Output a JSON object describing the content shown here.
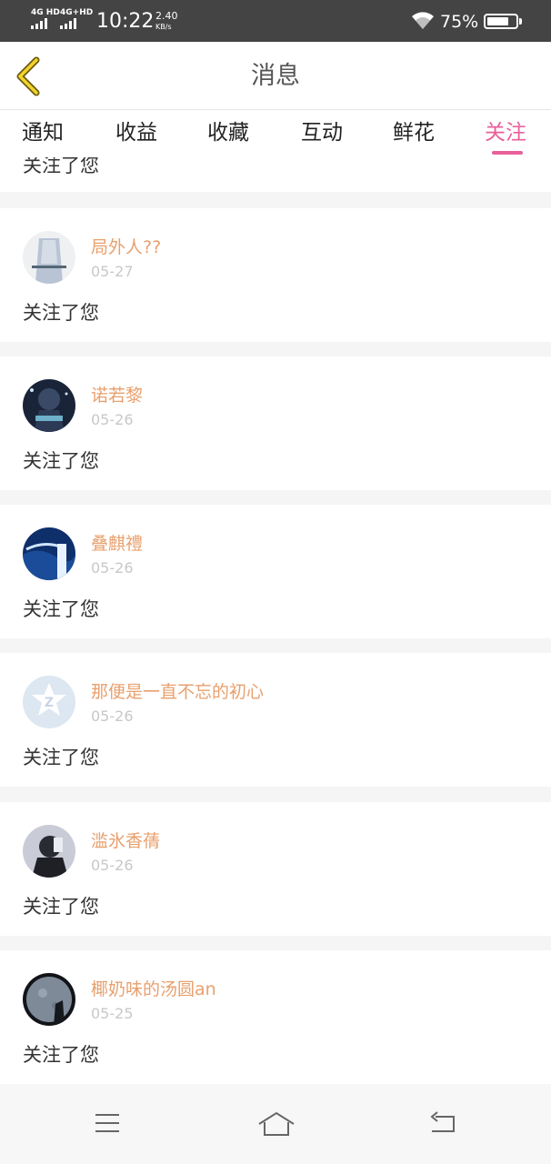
{
  "status_bar": {
    "network_1": "4G HD",
    "network_2": "4G+HD",
    "time": "10:22",
    "speed": "2.40",
    "speed_unit": "KB/s",
    "battery_percent": "75%",
    "battery_level": 0.75
  },
  "header": {
    "title": "消息",
    "back_icon": "chevron-left-icon"
  },
  "tabs": [
    {
      "label": "通知"
    },
    {
      "label": "收益"
    },
    {
      "label": "收藏"
    },
    {
      "label": "互动"
    },
    {
      "label": "鲜花"
    },
    {
      "label": "关注",
      "active": true
    }
  ],
  "partial_item": {
    "text": "关注了您"
  },
  "items": [
    {
      "name": "局外人??",
      "date": "05-27",
      "text": "关注了您"
    },
    {
      "name": "诺若黎",
      "date": "05-26",
      "text": "关注了您"
    },
    {
      "name": "叠麒禮",
      "date": "05-26",
      "text": "关注了您"
    },
    {
      "name": "那便是一直不忘的初心",
      "date": "05-26",
      "text": "关注了您"
    },
    {
      "name": "滥氷香蒨",
      "date": "05-26",
      "text": "关注了您"
    },
    {
      "name": "椰奶味的汤圆an",
      "date": "05-25",
      "text": "关注了您"
    }
  ],
  "navbar": {
    "menu_icon": "menu-icon",
    "home_icon": "home-icon",
    "back_icon": "back-arrow-icon"
  },
  "colors": {
    "accent": "#e8609a",
    "username": "#e8a06e",
    "status_bar_bg": "#444444",
    "back_arrow": "#e0c020"
  }
}
